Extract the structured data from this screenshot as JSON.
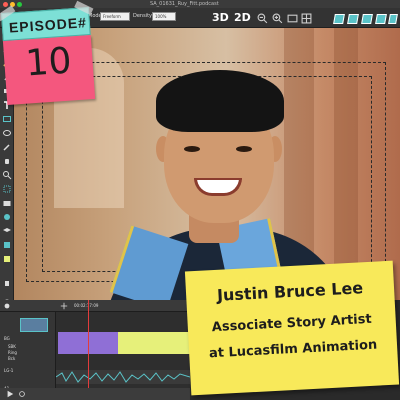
{
  "window": {
    "title": "SA_01631_Ruy_Fitt.podcast"
  },
  "toolbar": {
    "mode_label": "Mode:",
    "mode_value": "Freeform",
    "density_label": "Density:",
    "density_value": "100%",
    "btn_3d": "3D",
    "btn_2d": "2D"
  },
  "episode": {
    "label": "EPISODE#",
    "number": "10"
  },
  "guest": {
    "name": "Justin Bruce Lee",
    "role": "Associate Story Artist",
    "company": "at Lucasfilm Animation"
  },
  "timeline": {
    "timecode": "00:02:17:09",
    "layers": [
      "BG",
      "SBK",
      "Ring",
      "Bck",
      "LG-1",
      "A1"
    ],
    "colors": {
      "clip_a": "#8f6fd6",
      "clip_b": "#e6f07a",
      "wave": "#5ac3c8",
      "playhead": "#e23c3c"
    }
  },
  "colors": {
    "episode_top": "#7de0d6",
    "episode_bottom": "#f4577e",
    "name_note": "#f8e95a"
  }
}
